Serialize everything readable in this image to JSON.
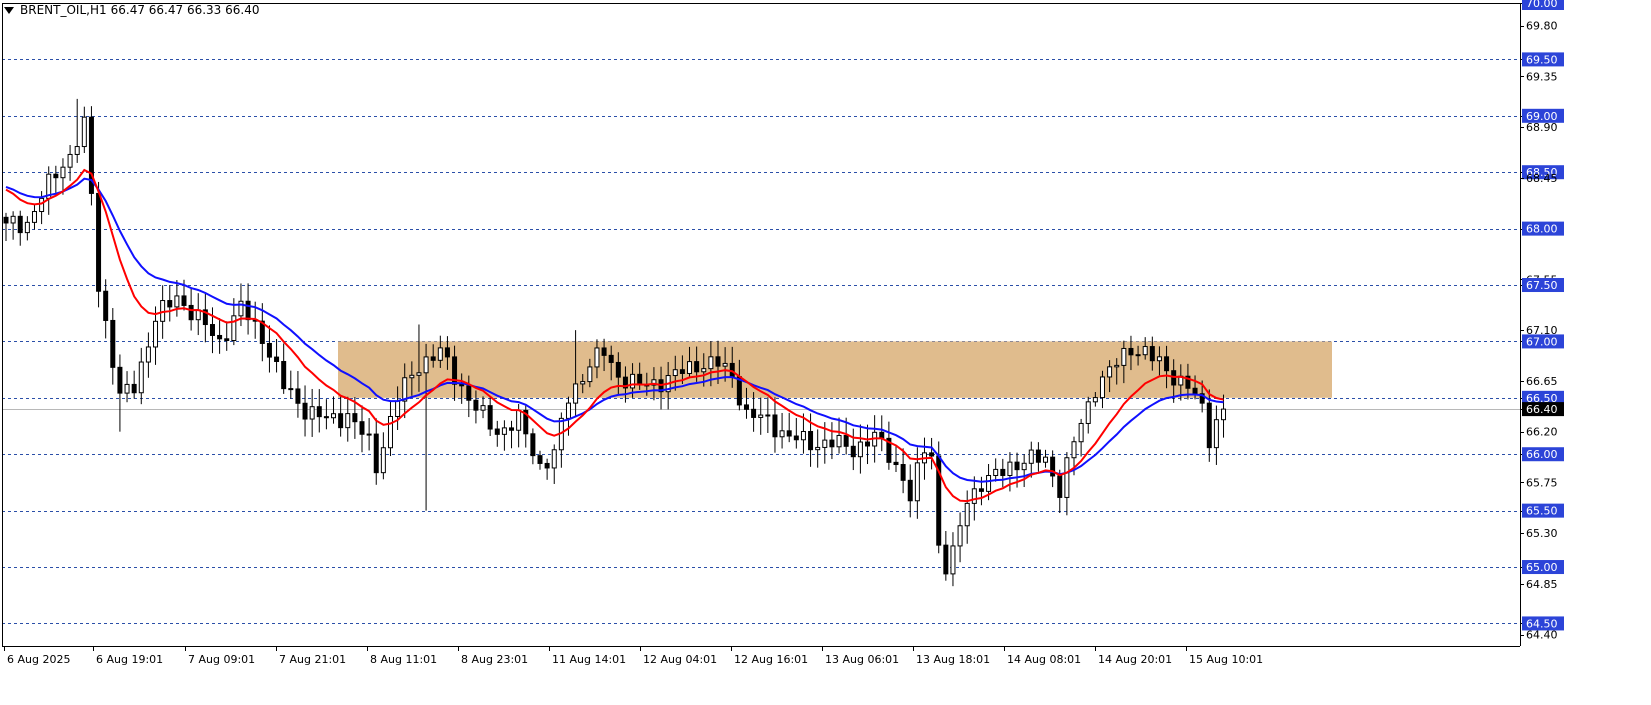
{
  "header": {
    "symbol_timeframe": "BRENT_OIL,H1",
    "ohlc": "66.47 66.47 66.33 66.40"
  },
  "chart_data": {
    "type": "candlestick",
    "symbol": "BRENT_OIL",
    "timeframe": "H1",
    "ylim": [
      64.3,
      70.0
    ],
    "y_tick_labels": [
      "70.00",
      "69.80",
      "69.50",
      "69.35",
      "69.00",
      "68.90",
      "68.50",
      "68.45",
      "68.00",
      "67.55",
      "67.50",
      "67.10",
      "67.00",
      "66.65",
      "66.50",
      "66.40",
      "66.20",
      "66.00",
      "65.75",
      "65.50",
      "65.30",
      "65.00",
      "64.85",
      "64.50",
      "64.40"
    ],
    "highlighted_levels": [
      "70.00",
      "69.50",
      "69.00",
      "68.50",
      "68.00",
      "67.50",
      "67.00",
      "66.50",
      "66.00",
      "65.50",
      "65.00",
      "64.50"
    ],
    "dashed_levels": [
      70.0,
      69.5,
      69.0,
      68.5,
      68.0,
      67.5,
      67.0,
      66.5,
      66.0,
      65.5,
      65.0,
      64.5
    ],
    "current_price": "66.40",
    "x_tick_labels": [
      "6 Aug 2025",
      "6 Aug 19:01",
      "7 Aug 09:01",
      "7 Aug 21:01",
      "8 Aug 11:01",
      "8 Aug 23:01",
      "11 Aug 14:01",
      "12 Aug 04:01",
      "12 Aug 16:01",
      "13 Aug 06:01",
      "13 Aug 18:01",
      "14 Aug 08:01",
      "14 Aug 20:01",
      "15 Aug 10:01"
    ],
    "zone": {
      "low": 66.5,
      "high": 67.0,
      "color": "#deb887"
    },
    "colors": {
      "background": "#ffffff",
      "grid": "#2b4fa8",
      "bull_fill": "#ffffff",
      "bear_fill": "#000000",
      "ma_fast": "#ff0000",
      "ma_slow": "#1010ff",
      "label_bg": "#2c44d8",
      "price_bg": "#000000"
    },
    "anchors": [
      [
        0,
        68.05
      ],
      [
        3,
        68.05
      ],
      [
        7,
        68.5
      ],
      [
        9,
        68.65
      ],
      [
        11,
        68.9
      ],
      [
        12,
        68.3
      ],
      [
        13,
        67.5
      ],
      [
        16,
        66.5
      ],
      [
        18,
        66.6
      ],
      [
        21,
        67.2
      ],
      [
        24,
        67.4
      ],
      [
        27,
        67.2
      ],
      [
        30,
        67.0
      ],
      [
        33,
        67.3
      ],
      [
        36,
        67.05
      ],
      [
        39,
        66.6
      ],
      [
        42,
        66.4
      ],
      [
        45,
        66.3
      ],
      [
        48,
        66.35
      ],
      [
        51,
        66.1
      ],
      [
        52,
        65.9
      ],
      [
        55,
        66.5
      ],
      [
        58,
        66.8
      ],
      [
        61,
        66.9
      ],
      [
        63,
        66.7
      ],
      [
        66,
        66.4
      ],
      [
        69,
        66.2
      ],
      [
        72,
        66.3
      ],
      [
        75,
        65.9
      ],
      [
        77,
        66.0
      ],
      [
        79,
        66.5
      ],
      [
        82,
        66.8
      ],
      [
        84,
        66.9
      ],
      [
        86,
        66.7
      ],
      [
        89,
        66.6
      ],
      [
        92,
        66.65
      ],
      [
        94,
        66.7
      ],
      [
        97,
        66.8
      ],
      [
        100,
        66.8
      ],
      [
        102,
        66.7
      ],
      [
        104,
        66.35
      ],
      [
        107,
        66.3
      ],
      [
        110,
        66.15
      ],
      [
        113,
        66.1
      ],
      [
        116,
        66.1
      ],
      [
        119,
        66.05
      ],
      [
        122,
        66.15
      ],
      [
        124,
        66.0
      ],
      [
        126,
        65.8
      ],
      [
        127,
        65.6
      ],
      [
        129,
        66.05
      ],
      [
        130,
        66.0
      ],
      [
        131,
        65.2
      ],
      [
        132,
        65.0
      ],
      [
        133,
        65.1
      ],
      [
        135,
        65.6
      ],
      [
        137,
        65.75
      ],
      [
        139,
        65.8
      ],
      [
        141,
        65.9
      ],
      [
        143,
        65.95
      ],
      [
        146,
        65.95
      ],
      [
        148,
        65.7
      ],
      [
        150,
        66.1
      ],
      [
        153,
        66.6
      ],
      [
        156,
        66.8
      ],
      [
        158,
        66.95
      ],
      [
        160,
        66.9
      ],
      [
        162,
        66.8
      ],
      [
        164,
        66.7
      ],
      [
        166,
        66.6
      ],
      [
        168,
        66.4
      ],
      [
        169,
        66.15
      ],
      [
        170,
        66.3
      ],
      [
        171,
        66.4
      ]
    ]
  }
}
